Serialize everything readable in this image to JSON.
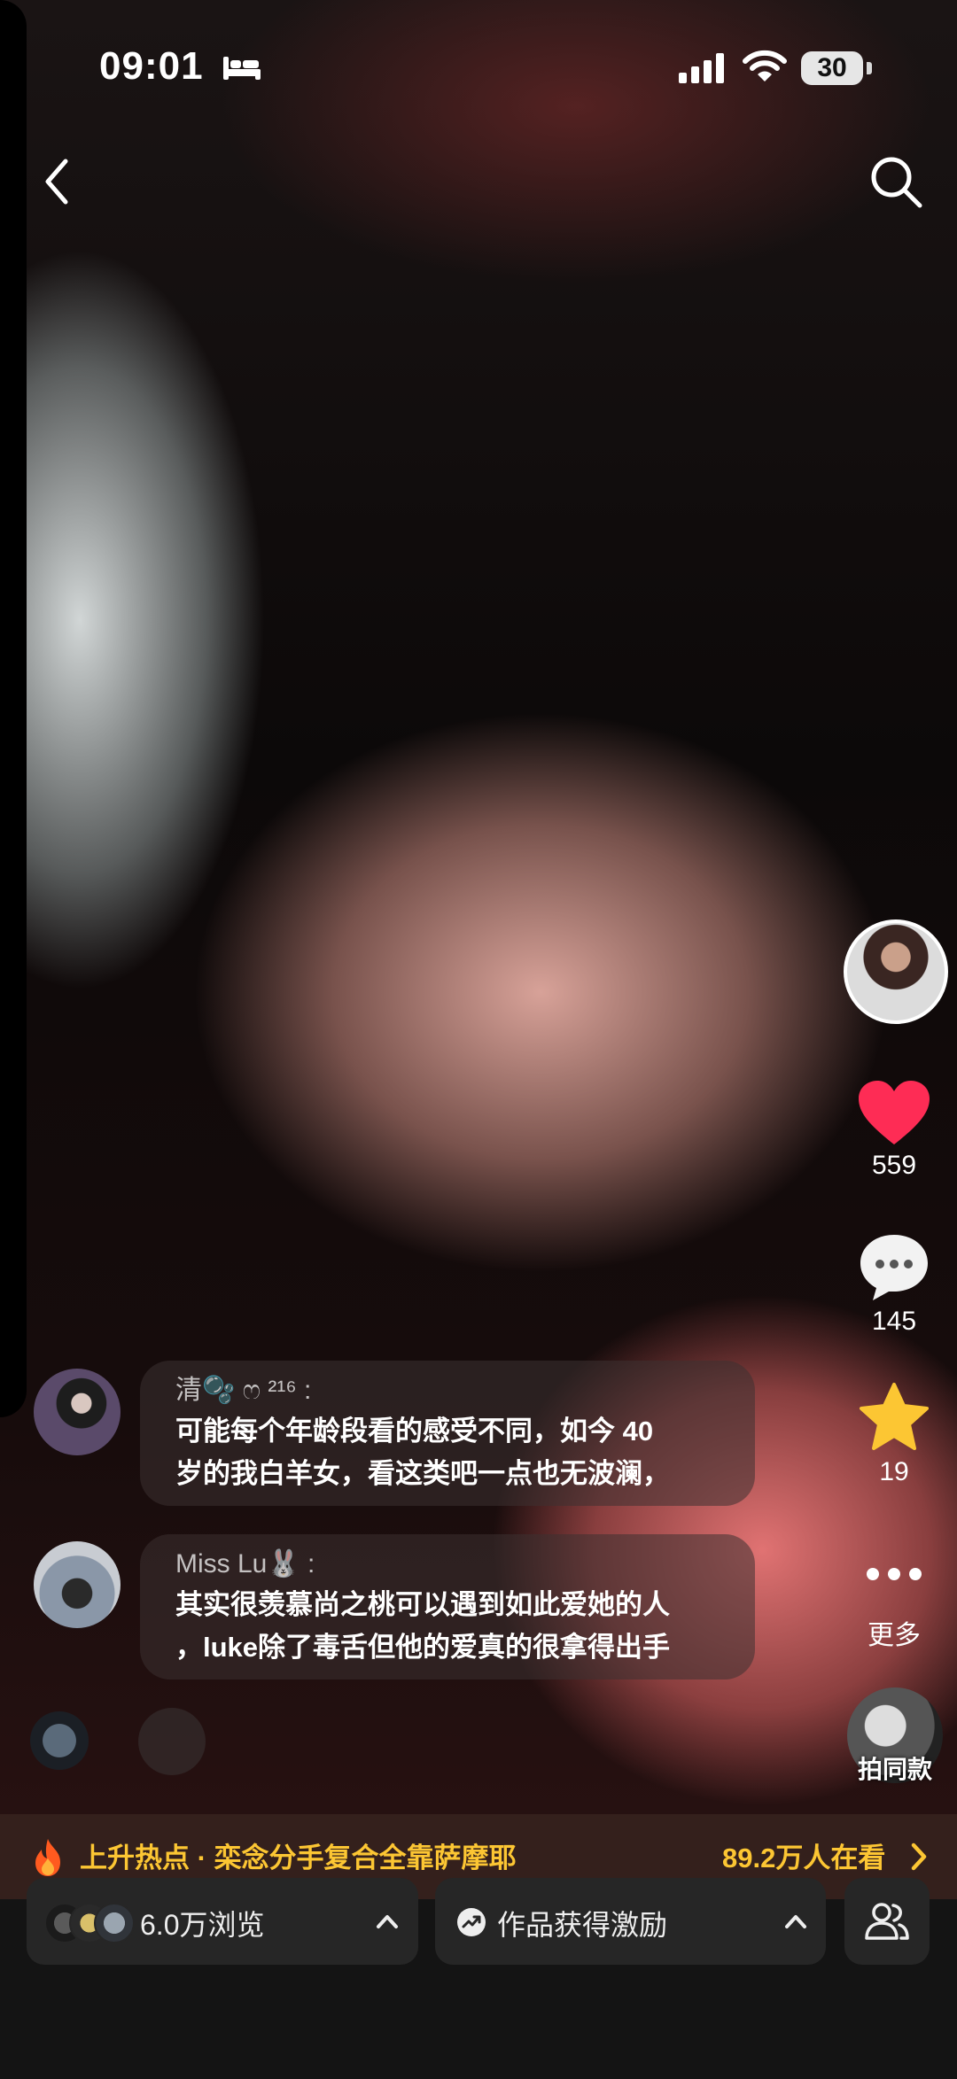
{
  "status_bar": {
    "time": "09:01",
    "battery": "30"
  },
  "icons": {
    "sleep": "bed-icon",
    "signal": "signal-icon",
    "wifi": "wifi-icon",
    "back": "chevron-left-icon",
    "search": "search-icon",
    "like": "heart-icon",
    "comment": "comment-bubble-icon",
    "favorite": "star-icon",
    "more": "ellipsis-icon",
    "hot": "flame-icon",
    "incentive": "trending-icon",
    "friends": "people-icon"
  },
  "actions": {
    "likes": "559",
    "comments": "145",
    "favorites": "19",
    "more_label": "更多",
    "same_style_label": "拍同款"
  },
  "comments": [
    {
      "user": "清🫧 ෆ ²¹⁶ :",
      "lines": [
        "可能每个年龄段看的感受不同，如今 40",
        "岁的我白羊女，看这类吧一点也无波澜，"
      ]
    },
    {
      "user": "Miss Lu🐰 :",
      "lines": [
        "其实很羡慕尚之桃可以遇到如此爱她的人",
        "，luke除了毒舌但他的爱真的很拿得出手"
      ]
    }
  ],
  "hot_topic": {
    "label": "上升热点 · 栾念分手复合全靠萨摩耶",
    "viewers": "89.2万人在看"
  },
  "bottom_bar": {
    "views": "6.0万浏览",
    "incentive": "作品获得激励"
  },
  "colors": {
    "like_red": "#fe2c55",
    "star_yellow": "#fcc633",
    "hot_text": "#fcc633"
  }
}
